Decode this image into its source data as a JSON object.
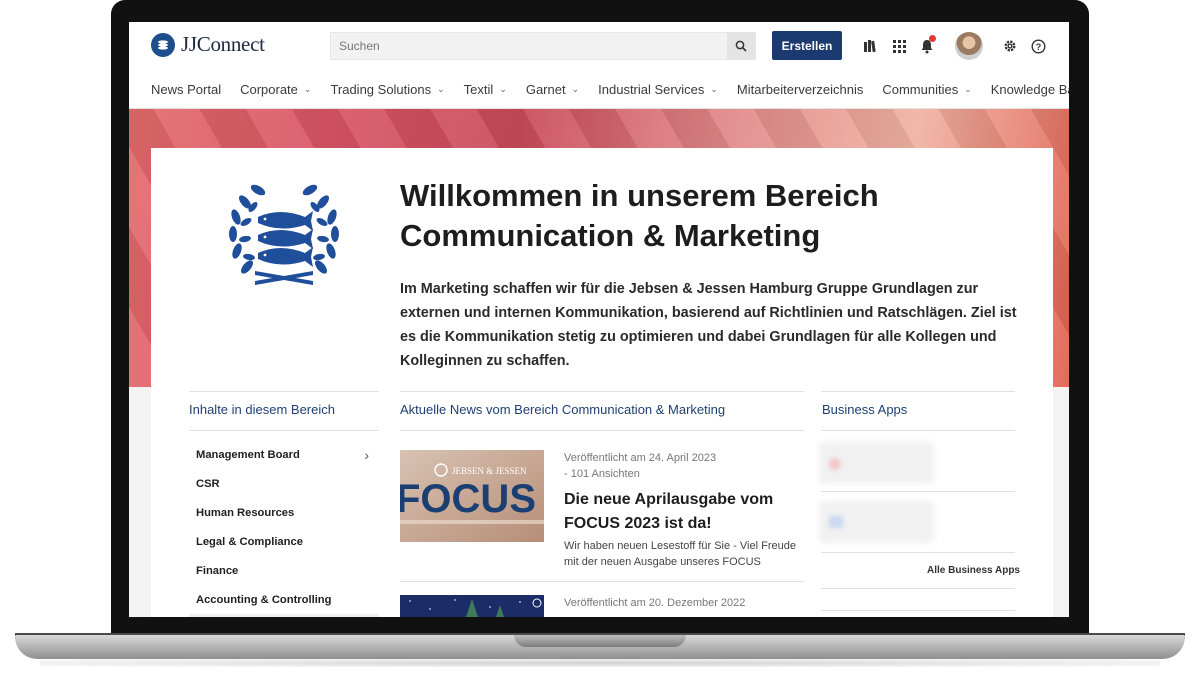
{
  "header": {
    "logo_text": "JJConnect",
    "search_placeholder": "Suchen",
    "create_label": "Erstellen"
  },
  "nav": {
    "items": [
      {
        "label": "News Portal",
        "has_dropdown": false
      },
      {
        "label": "Corporate",
        "has_dropdown": true
      },
      {
        "label": "Trading Solutions",
        "has_dropdown": true
      },
      {
        "label": "Textil",
        "has_dropdown": true
      },
      {
        "label": "Garnet",
        "has_dropdown": true
      },
      {
        "label": "Industrial Services",
        "has_dropdown": true
      },
      {
        "label": "Mitarbeiterverzeichnis",
        "has_dropdown": false
      },
      {
        "label": "Communities",
        "has_dropdown": true
      },
      {
        "label": "Knowledge Base",
        "has_dropdown": true
      }
    ]
  },
  "hero": {
    "title_line1": "Willkommen in unserem Bereich",
    "title_line2": "Communication & Marketing",
    "lead": "Im Marketing schaffen wir für die Jebsen & Jessen Hamburg Gruppe Grundlagen zur externen und internen Kommunikation, basierend auf Richtlinien und Ratschlägen. Ziel ist es die Kommunikation stetig zu optimieren und dabei Grundlagen für alle Kollegen und Kolleginnen zu schaffen."
  },
  "sidebar": {
    "title": "Inhalte in diesem Bereich",
    "items": [
      {
        "label": "Management Board",
        "arrow": "›"
      },
      {
        "label": "CSR"
      },
      {
        "label": "Human Resources"
      },
      {
        "label": "Legal & Compliance"
      },
      {
        "label": "Finance"
      },
      {
        "label": "Accounting & Controlling"
      }
    ]
  },
  "news": {
    "title": "Aktuelle News vom Bereich Communication & Marketing",
    "items": [
      {
        "meta1": "Veröffentlicht am 24. April 2023",
        "meta2": "- 101 Ansichten",
        "title": "Die neue Aprilausgabe vom FOCUS 2023 ist da!",
        "text": "Wir haben neuen Lesestoff für Sie - Viel Freude mit der neuen Ausgabe unseres FOCUS",
        "thumb_brand": "JEBSEN & JESSEN",
        "thumb_word": "FOCUS"
      },
      {
        "meta1": "Veröffentlicht am 20. Dezember 2022"
      }
    ]
  },
  "apps": {
    "title": "Business Apps",
    "all_label": "Alle Business Apps"
  },
  "colors": {
    "brand": "#1b3a6f",
    "link": "#1f3f72",
    "notification": "#e53935"
  }
}
